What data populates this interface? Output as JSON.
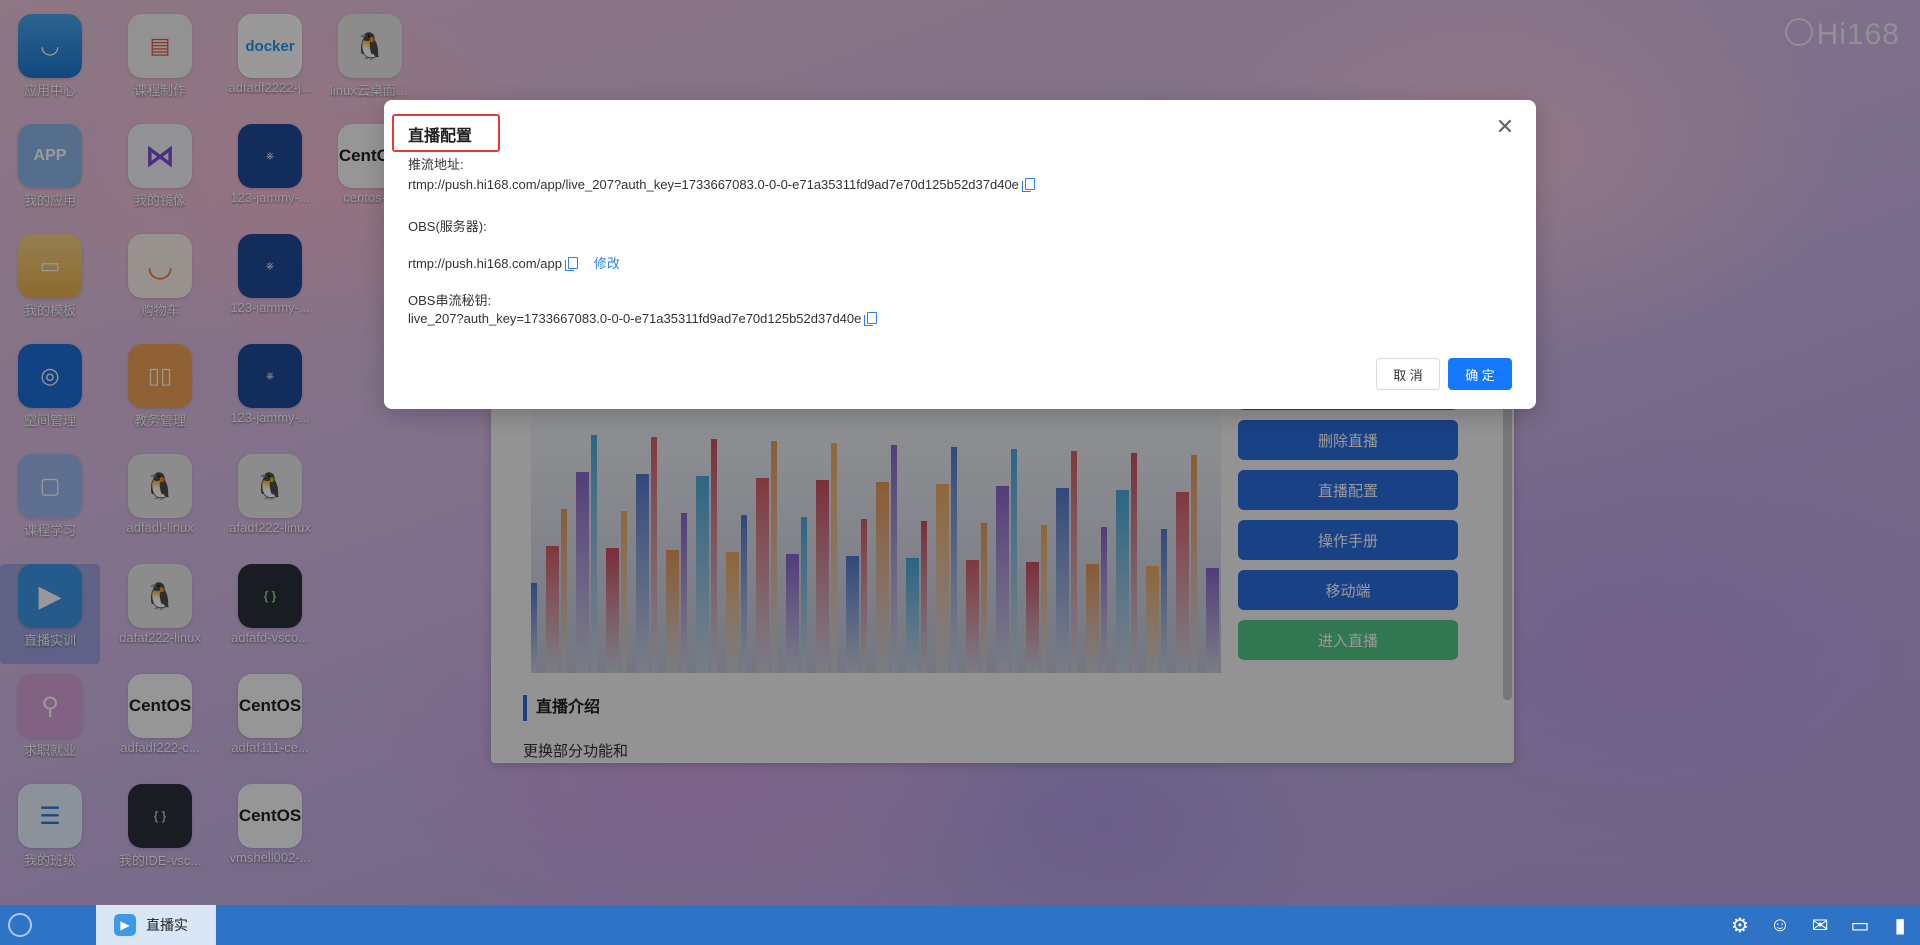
{
  "brand": {
    "name": "Hi168"
  },
  "desktop": {
    "icons": [
      {
        "label": "应用中心",
        "glyph": "◡",
        "style": "t-blue",
        "name": "app-center-icon"
      },
      {
        "label": "课程制作",
        "glyph": "▤",
        "style": "t-paper",
        "name": "course-make-icon"
      },
      {
        "label": "adfadf2222-j...",
        "glyph": "docker",
        "style": "t-docker",
        "name": "docker-icon"
      },
      {
        "label": "linux云桌面-...",
        "glyph": "🐧",
        "style": "t-linux",
        "name": "linux-penguin-icon"
      },
      {
        "label": "我的应用",
        "glyph": "APP",
        "style": "t-app",
        "name": "my-apps-icon"
      },
      {
        "label": "我的镜像",
        "glyph": "⋈",
        "style": "t-vs",
        "name": "my-image-icon"
      },
      {
        "label": "123-jammy-...",
        "glyph": "⎈",
        "style": "t-k8s",
        "name": "kubernetes-icon"
      },
      {
        "label": "centos-...",
        "glyph": "CentOS",
        "style": "t-centos",
        "name": "centos-icon"
      },
      {
        "label": "我的模板",
        "glyph": "▭",
        "style": "t-folder",
        "name": "folder-icon"
      },
      {
        "label": "购物车",
        "glyph": "◡",
        "style": "t-smile",
        "name": "cart-icon"
      },
      {
        "label": "123-jammy-...",
        "glyph": "⎈",
        "style": "t-k8s",
        "name": "kubernetes-icon"
      },
      {
        "label": "空间管理",
        "glyph": "◎",
        "style": "t-space",
        "name": "space-manage-icon"
      },
      {
        "label": "教务管理",
        "glyph": "▯▯",
        "style": "t-office",
        "name": "academic-manage-icon"
      },
      {
        "label": "123-jammy-...",
        "glyph": "⎈",
        "style": "t-k8s",
        "name": "kubernetes-icon"
      },
      {
        "label": "课程学习",
        "glyph": "▢",
        "style": "t-learn",
        "name": "course-learn-icon"
      },
      {
        "label": "adfadf-linux",
        "glyph": "🐧",
        "style": "t-linux",
        "name": "linux-penguin-icon"
      },
      {
        "label": "afadf222-linux",
        "glyph": "🐧",
        "style": "t-linux",
        "name": "linux-penguin-icon"
      },
      {
        "label": "直播实训",
        "glyph": "▶",
        "style": "t-play",
        "name": "live-training-icon"
      },
      {
        "label": "dafaf222-linux",
        "glyph": "🐧",
        "style": "t-linux",
        "name": "linux-penguin-icon"
      },
      {
        "label": "adfafd-vsco...",
        "glyph": "{ }",
        "style": "t-code",
        "name": "vscode-icon"
      },
      {
        "label": "求职就业",
        "glyph": "⚲",
        "style": "t-key",
        "name": "job-icon"
      },
      {
        "label": "adfadf222-c...",
        "glyph": "CentOS",
        "style": "t-centos",
        "name": "centos-icon"
      },
      {
        "label": "adfaf111-ce...",
        "glyph": "CentOS",
        "style": "t-centos",
        "name": "centos-icon"
      },
      {
        "label": "我的班级",
        "glyph": "☰",
        "style": "t-class",
        "name": "my-class-icon"
      },
      {
        "label": "我的IDE-vsc...",
        "glyph": "{ }",
        "style": "t-code",
        "name": "vscode-icon"
      },
      {
        "label": "vmshell002-...",
        "glyph": "CentOS",
        "style": "t-centos",
        "name": "centos-icon"
      }
    ]
  },
  "live_window": {
    "buttons": [
      "删除直播",
      "直播配置",
      "操作手册",
      "移动端",
      "进入直播"
    ],
    "section_title": "直播介绍",
    "intro_text": "更换部分功能和"
  },
  "dialog": {
    "title": "直播配置",
    "close_glyph": "✕",
    "push_url_label": "推流地址:",
    "push_url_value": "rtmp://push.hi168.com/app/live_207?auth_key=1733667083.0-0-0-e71a35311fd9ad7e70d125b52d37d40e",
    "obs_server_label": "OBS(服务器):",
    "obs_server_value": "rtmp://push.hi168.com/app",
    "edit_link": "修改",
    "obs_key_label": "OBS串流秘钥:",
    "obs_key_value": "live_207?auth_key=1733667083.0-0-0-e71a35311fd9ad7e70d125b52d37d40e",
    "cancel_label": "取 消",
    "ok_label": "确 定"
  },
  "taskbar": {
    "task_label": "直播实",
    "task_icon": "▶",
    "tray_icons": [
      "gear-icon",
      "wechat-icon",
      "chat-icon",
      "monitor-icon",
      "desktop-icon"
    ]
  },
  "colors": {
    "accent": "#1677ff",
    "highlight_box": "#e53935",
    "taskbar": "#2f73c7"
  }
}
